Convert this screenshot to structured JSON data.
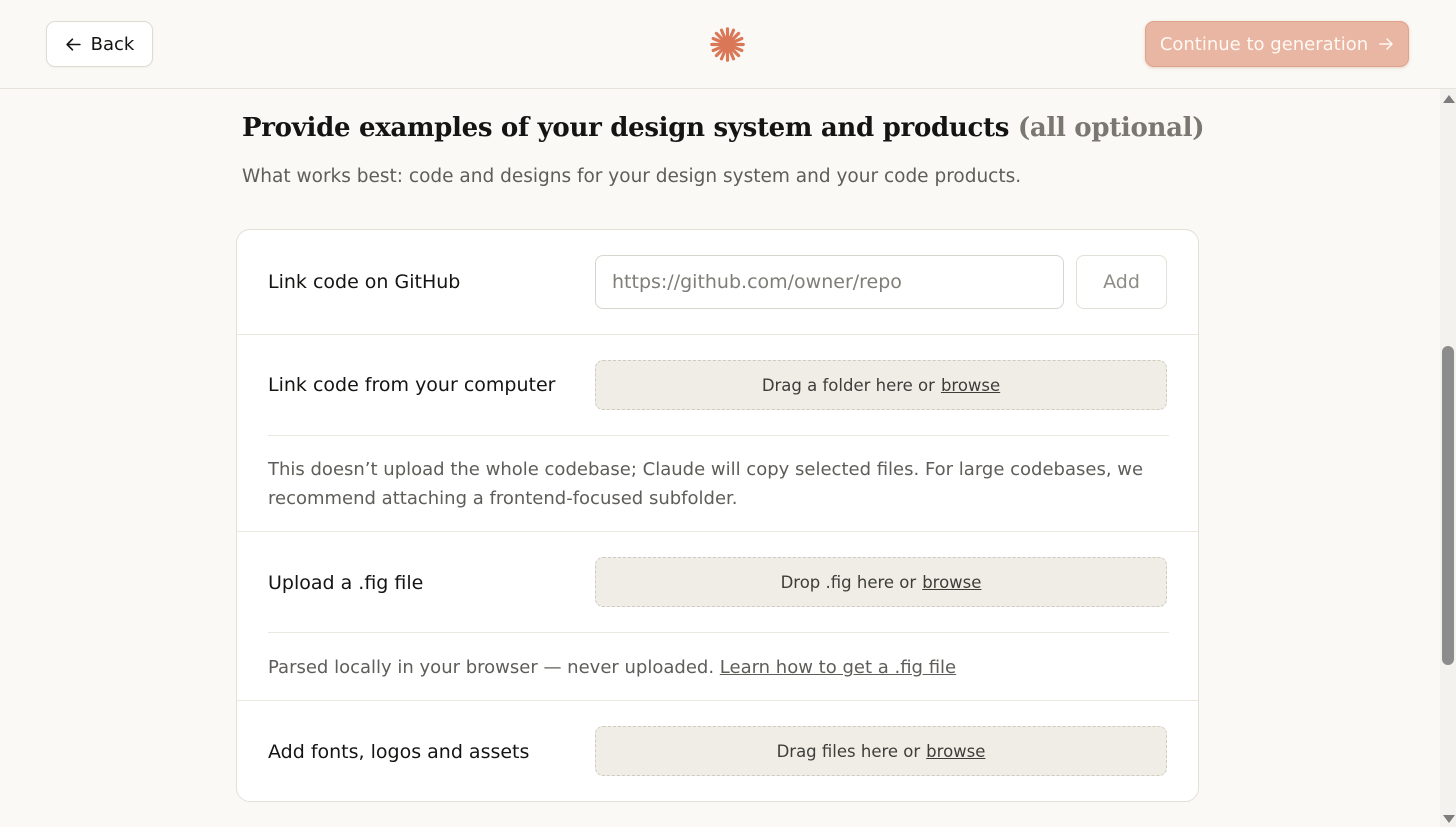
{
  "header": {
    "back_label": "Back",
    "continue_label": "Continue to generation",
    "accent_color": "#d97757"
  },
  "main": {
    "title": "Provide examples of your design system and products",
    "title_muted": "(all optional)",
    "subtitle": "What works best: code and designs for your design system and your code products."
  },
  "github": {
    "label": "Link code on GitHub",
    "placeholder": "https://github.com/owner/repo",
    "value": "",
    "add_label": "Add"
  },
  "computer": {
    "label": "Link code from your computer",
    "drop_text": "Drag a folder here or",
    "browse_label": "browse",
    "note": "This doesn’t upload the whole codebase; Claude will copy selected files. For large codebases, we recommend attaching a frontend-focused subfolder."
  },
  "fig": {
    "label": "Upload a .fig file",
    "drop_text": "Drop .fig here or",
    "browse_label": "browse",
    "note": "Parsed locally in your browser — never uploaded.",
    "note_link": "Learn how to get a .fig file"
  },
  "assets": {
    "label": "Add fonts, logos and assets",
    "drop_text": "Drag files here or",
    "browse_label": "browse"
  }
}
